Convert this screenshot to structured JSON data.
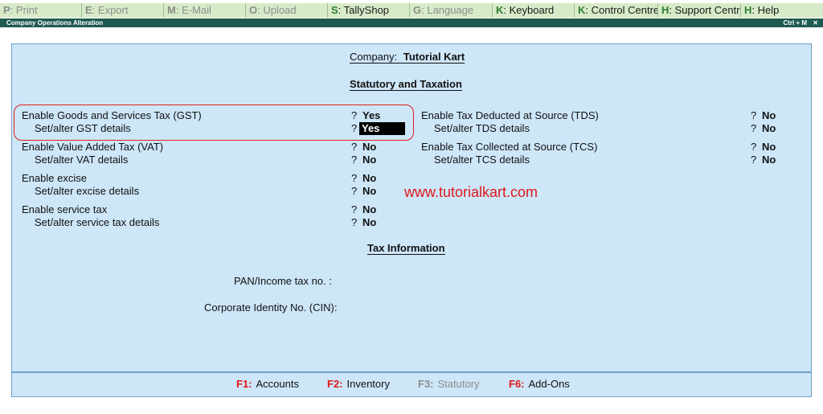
{
  "menu": [
    {
      "key": "P",
      "label": ": Print",
      "enabled": false
    },
    {
      "key": "E",
      "label": ": Export",
      "enabled": false
    },
    {
      "key": "M",
      "label": ": E-Mail",
      "enabled": false
    },
    {
      "key": "O",
      "label": ": Upload",
      "enabled": false
    },
    {
      "key": "S",
      "label": ": TallyShop",
      "enabled": true
    },
    {
      "key": "G",
      "label": ": Language",
      "enabled": false
    },
    {
      "key": "K",
      "label": ": Keyboard",
      "enabled": true
    },
    {
      "key": "K",
      "label": ": Control Centre",
      "enabled": true
    },
    {
      "key": "H",
      "label": ": Support Centre",
      "enabled": true
    },
    {
      "key": "H",
      "label": ": Help",
      "enabled": true
    }
  ],
  "titlebar": {
    "left": "Company Operations  Alteration",
    "right": "Ctrl + M",
    "close": "✕"
  },
  "company": {
    "label": "Company:",
    "name": "Tutorial Kart"
  },
  "section_statutory": "Statutory and Taxation",
  "left_fields": [
    {
      "label": "Enable Goods and Services Tax (GST)",
      "q": "?",
      "value": "Yes"
    },
    {
      "label": "Set/alter GST details",
      "q": "?",
      "value": "Yes"
    },
    {
      "label": "Enable Value Added Tax (VAT)",
      "q": "?",
      "value": "No"
    },
    {
      "label": "Set/alter VAT details",
      "q": "?",
      "value": "No"
    },
    {
      "label": "Enable excise",
      "q": "?",
      "value": "No"
    },
    {
      "label": "Set/alter excise details",
      "q": "?",
      "value": "No"
    },
    {
      "label": "Enable service tax",
      "q": "?",
      "value": "No"
    },
    {
      "label": "Set/alter service tax details",
      "q": "?",
      "value": "No"
    }
  ],
  "right_fields": [
    {
      "label": "Enable Tax Deducted at Source (TDS)",
      "q": "?",
      "value": "No"
    },
    {
      "label": "Set/alter TDS details",
      "q": "?",
      "value": "No"
    },
    {
      "label": "Enable Tax Collected at Source (TCS)",
      "q": "?",
      "value": "No"
    },
    {
      "label": "Set/alter TCS details",
      "q": "?",
      "value": "No"
    }
  ],
  "watermark": "www.tutorialkart.com",
  "section_tax_info": "Tax Information",
  "pan_label": "PAN/Income tax no. :",
  "cin_label": "Corporate Identity No. (CIN):",
  "footer": [
    {
      "key": "F1:",
      "label": "Accounts",
      "enabled": true
    },
    {
      "key": "F2:",
      "label": "Inventory",
      "enabled": true
    },
    {
      "key": "F3:",
      "label": "Statutory",
      "enabled": false
    },
    {
      "key": "F6:",
      "label": "Add-Ons",
      "enabled": true
    }
  ],
  "colors": {
    "accent_green": "#2e7d32",
    "menubar": "#d8ebc8",
    "titlebar": "#1f5a52",
    "panel": "#cde6f8",
    "highlight_red": "#e01818"
  }
}
